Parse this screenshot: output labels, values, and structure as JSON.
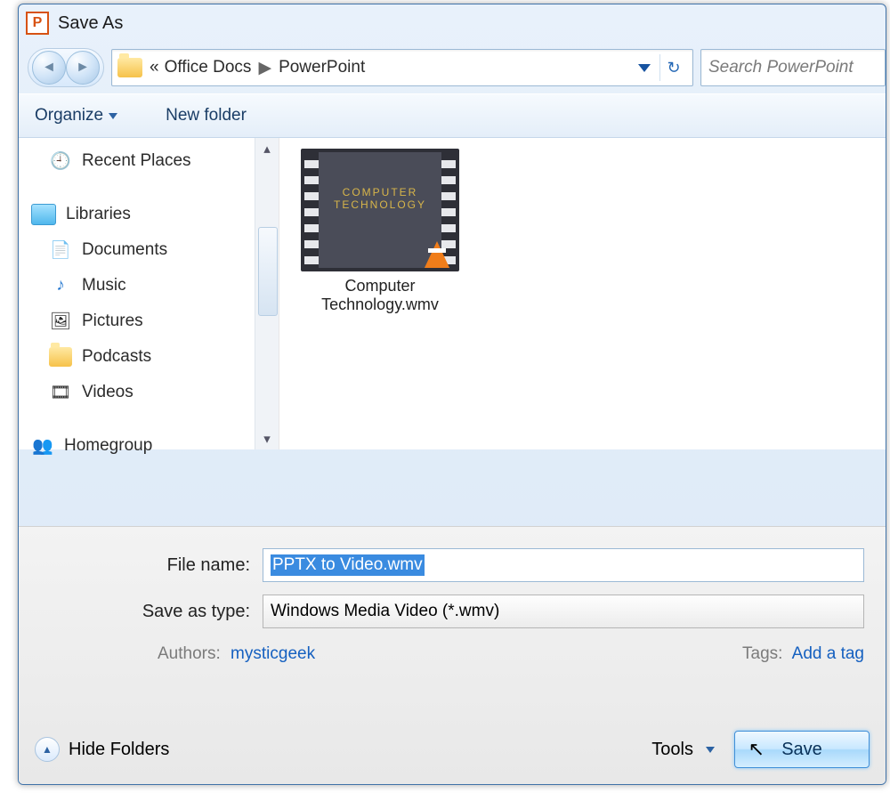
{
  "window": {
    "title": "Save As"
  },
  "address": {
    "prefix": "«",
    "segments": [
      "Office Docs",
      "PowerPoint"
    ]
  },
  "search": {
    "placeholder": "Search PowerPoint"
  },
  "toolbar": {
    "organize": "Organize",
    "new_folder": "New folder"
  },
  "sidebar": {
    "recent_places": "Recent Places",
    "libraries": "Libraries",
    "documents": "Documents",
    "music": "Music",
    "pictures": "Pictures",
    "podcasts": "Podcasts",
    "videos": "Videos",
    "homegroup": "Homegroup"
  },
  "files": [
    {
      "name": "Computer Technology.wmv",
      "thumb_text": "COMPUTER TECHNOLOGY"
    }
  ],
  "bottom": {
    "file_name_label": "File name:",
    "file_name_value": "PPTX to Video.wmv",
    "save_type_label": "Save as type:",
    "save_type_value": "Windows Media Video (*.wmv)",
    "authors_label": "Authors:",
    "authors_value": "mysticgeek",
    "tags_label": "Tags:",
    "tags_value": "Add a tag",
    "hide_folders": "Hide Folders",
    "tools": "Tools",
    "save": "Save"
  }
}
